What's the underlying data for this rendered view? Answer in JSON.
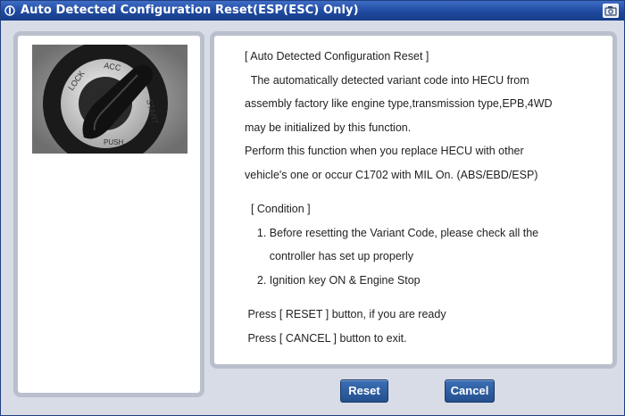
{
  "window": {
    "title": "Auto Detected Configuration Reset(ESP(ESC) Only)"
  },
  "image": {
    "description_icon": "ignition-key-icon",
    "labels": [
      "LOCK",
      "ACC",
      "START",
      "PUSH"
    ]
  },
  "content": {
    "heading": "[ Auto Detected Configuration Reset ]",
    "intro": [
      "  The automatically detected variant code into HECU from",
      "assembly factory like engine type,transmission type,EPB,4WD",
      "may be initialized by this function.",
      "Perform this function when you replace HECU with other",
      "vehicle's one or occur C1702 with MIL On. (ABS/EBD/ESP)"
    ],
    "condition_heading": "  [ Condition ]",
    "conditions": [
      "    1. Before resetting the Variant Code, please check all the",
      "        controller has set up properly",
      "    2. Ignition key ON & Engine Stop"
    ],
    "instructions": [
      " Press [ RESET ] button, if you are ready",
      " Press [ CANCEL ] button to exit."
    ]
  },
  "buttons": {
    "reset_label": "Reset",
    "cancel_label": "Cancel"
  },
  "colors": {
    "titlebar": "#1f4aa0",
    "button": "#2a5a9c",
    "panel_border": "#b9bfcc"
  }
}
